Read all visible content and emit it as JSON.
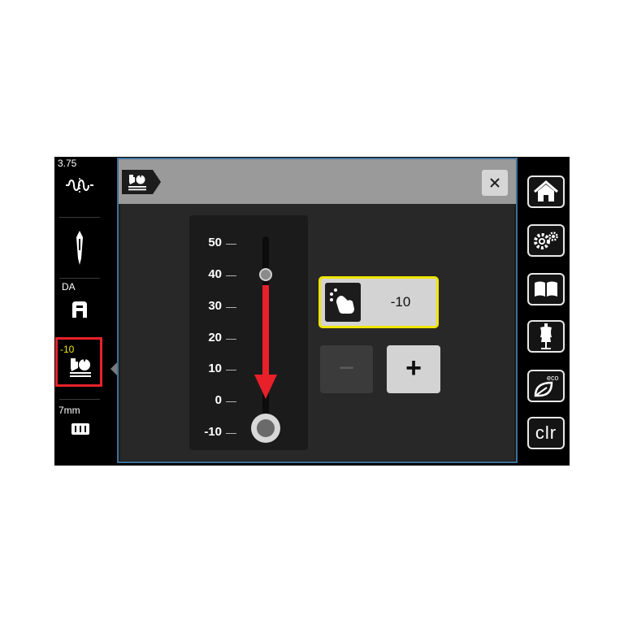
{
  "left_sidebar": {
    "items": [
      {
        "value": "3.75",
        "icon": "stitch-width-icon"
      },
      {
        "value": "",
        "icon": "needle-icon"
      },
      {
        "value": "DA",
        "icon": "presser-foot-icon"
      },
      {
        "value": "-10",
        "icon": "presser-foot-pressure-icon",
        "active": true,
        "value_color": "#f0e500"
      },
      {
        "value": "7mm",
        "icon": "stitch-plate-icon"
      }
    ],
    "active_frame_color": "#e8202a"
  },
  "dialog": {
    "header_icon": "presser-foot-pressure-icon",
    "close_icon": "close-icon",
    "scale": {
      "labels": [
        "50",
        "40",
        "30",
        "20",
        "10",
        "0",
        "-10"
      ],
      "marker_value": 40,
      "slider_value": -10,
      "arrow_color": "#e8202a",
      "arrow_from": 40,
      "arrow_to": -10
    },
    "value_display": {
      "icon": "finger-tap-icon",
      "value": "-10",
      "highlight_color": "#f0e500"
    },
    "minus_label": "−",
    "plus_label": "+"
  },
  "right_sidebar": {
    "buttons": [
      {
        "icon": "home-icon"
      },
      {
        "icon": "settings-gears-icon"
      },
      {
        "icon": "tutorial-book-icon"
      },
      {
        "icon": "dress-form-icon"
      },
      {
        "icon": "eco-leaf-icon",
        "text": "eco"
      },
      {
        "icon": "clear-icon",
        "text": "clr"
      }
    ]
  }
}
